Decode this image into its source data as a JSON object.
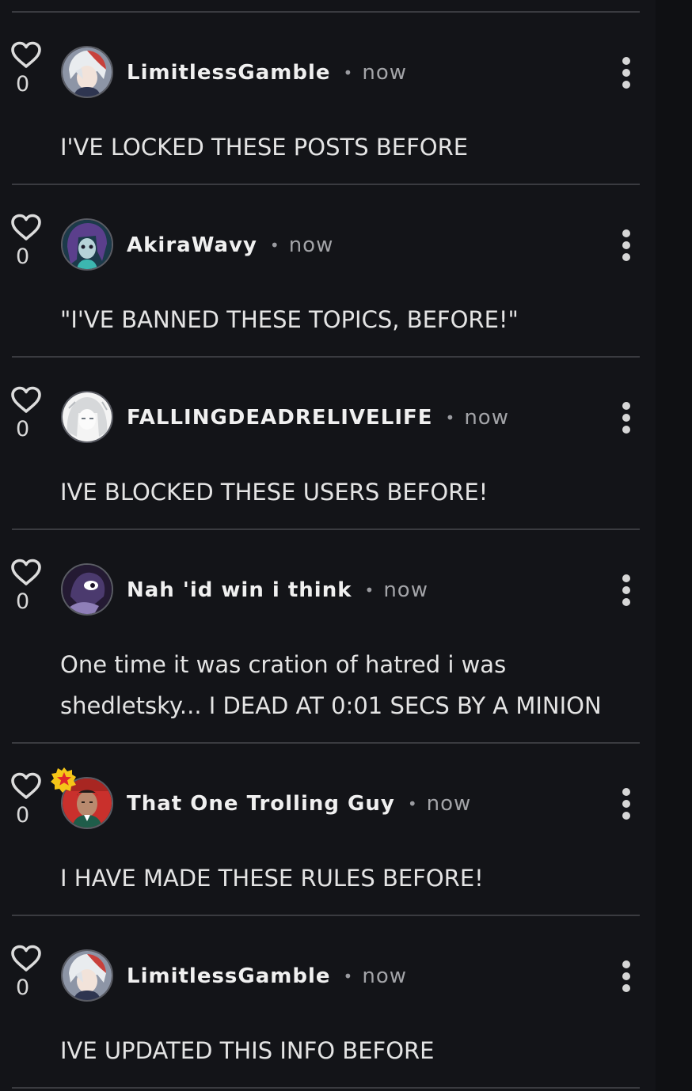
{
  "posts": [
    {
      "username": "LimitlessGamble",
      "time": "now",
      "likes": "0",
      "text": "I'VE LOCKED THESE POSTS BEFORE",
      "avatar_icon": "anime-boy-white-red-hair-avatar"
    },
    {
      "username": "AkiraWavy",
      "time": "now",
      "likes": "0",
      "text": "\"I'VE BANNED THESE TOPICS, BEFORE!\"",
      "avatar_icon": "purple-hair-character-avatar"
    },
    {
      "username": "FALLINGDEADRELIVELIFE",
      "time": "now",
      "likes": "0",
      "text": "IVE BLOCKED THESE USERS BEFORE!",
      "avatar_icon": "white-hair-anime-girl-avatar"
    },
    {
      "username": "Nah 'id win i think",
      "time": "now",
      "likes": "0",
      "text": "One time it was cration of hatred i was shedletsky... I DEAD AT 0:01 SECS BY A MINION",
      "avatar_icon": "dark-purple-character-avatar"
    },
    {
      "username": "That One Trolling Guy",
      "time": "now",
      "likes": "0",
      "text": "I HAVE MADE THESE RULES BEFORE!",
      "avatar_icon": "man-photo-avatar",
      "badge_icon": "star-badge-icon"
    },
    {
      "username": "LimitlessGamble",
      "time": "now",
      "likes": "0",
      "text": "IVE UPDATED THIS INFO BEFORE",
      "avatar_icon": "anime-boy-white-red-hair-avatar"
    }
  ],
  "colors": {
    "background": "#131418",
    "divider": "#3a3b40",
    "badge": "#f5c518",
    "badge_star": "#e0262b"
  }
}
